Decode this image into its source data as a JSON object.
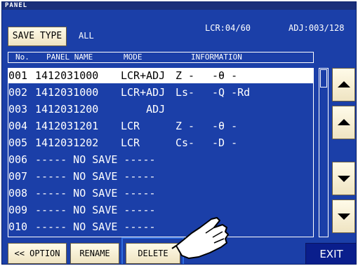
{
  "title_bar": {
    "text": "PANEL"
  },
  "save_type": {
    "button_label": "SAVE TYPE",
    "value": "ALL"
  },
  "counts": {
    "lcr": "LCR:04/60",
    "adj": "ADJ:003/128"
  },
  "columns": {
    "no": "No.",
    "panel_name": "PANEL NAME",
    "mode": "MODE",
    "information": "INFORMATION"
  },
  "rows": [
    {
      "no": "001",
      "name": "1412031000",
      "mode": "LCR+ADJ",
      "p1": "Z -",
      "p2": "-θ -",
      "selected": true
    },
    {
      "no": "002",
      "name": "1412031000",
      "mode": "LCR+ADJ",
      "p1": "Ls-",
      "p2": "-Q -Rd"
    },
    {
      "no": "003",
      "name": "1412031200",
      "mode": "    ADJ",
      "p1": "",
      "p2": ""
    },
    {
      "no": "004",
      "name": "1412031201",
      "mode": "LCR",
      "p1": "Z -",
      "p2": "-θ -"
    },
    {
      "no": "005",
      "name": "1412031202",
      "mode": "LCR",
      "p1": "Cs-",
      "p2": "-D -"
    },
    {
      "no": "006",
      "name": "----- NO SAVE -----",
      "mode": "",
      "p1": "",
      "p2": ""
    },
    {
      "no": "007",
      "name": "----- NO SAVE -----",
      "mode": "",
      "p1": "",
      "p2": ""
    },
    {
      "no": "008",
      "name": "----- NO SAVE -----",
      "mode": "",
      "p1": "",
      "p2": ""
    },
    {
      "no": "009",
      "name": "----- NO SAVE -----",
      "mode": "",
      "p1": "",
      "p2": ""
    },
    {
      "no": "010",
      "name": "----- NO SAVE -----",
      "mode": "",
      "p1": "",
      "p2": ""
    }
  ],
  "bottom_buttons": {
    "option": "<< OPTION",
    "rename": "RENAME",
    "delete": "DELETE",
    "exit": "EXIT"
  },
  "nav_icons": {
    "top": "arrow-up-icon",
    "page_up": "triangle-up-icon",
    "page_down": "triangle-down-icon",
    "bottom": "arrow-down-icon"
  },
  "colors": {
    "background": "#1b3fa8",
    "button_face": "#f7efd6",
    "exit_button": "#0a1e8c",
    "highlight": "#2f6de0"
  }
}
